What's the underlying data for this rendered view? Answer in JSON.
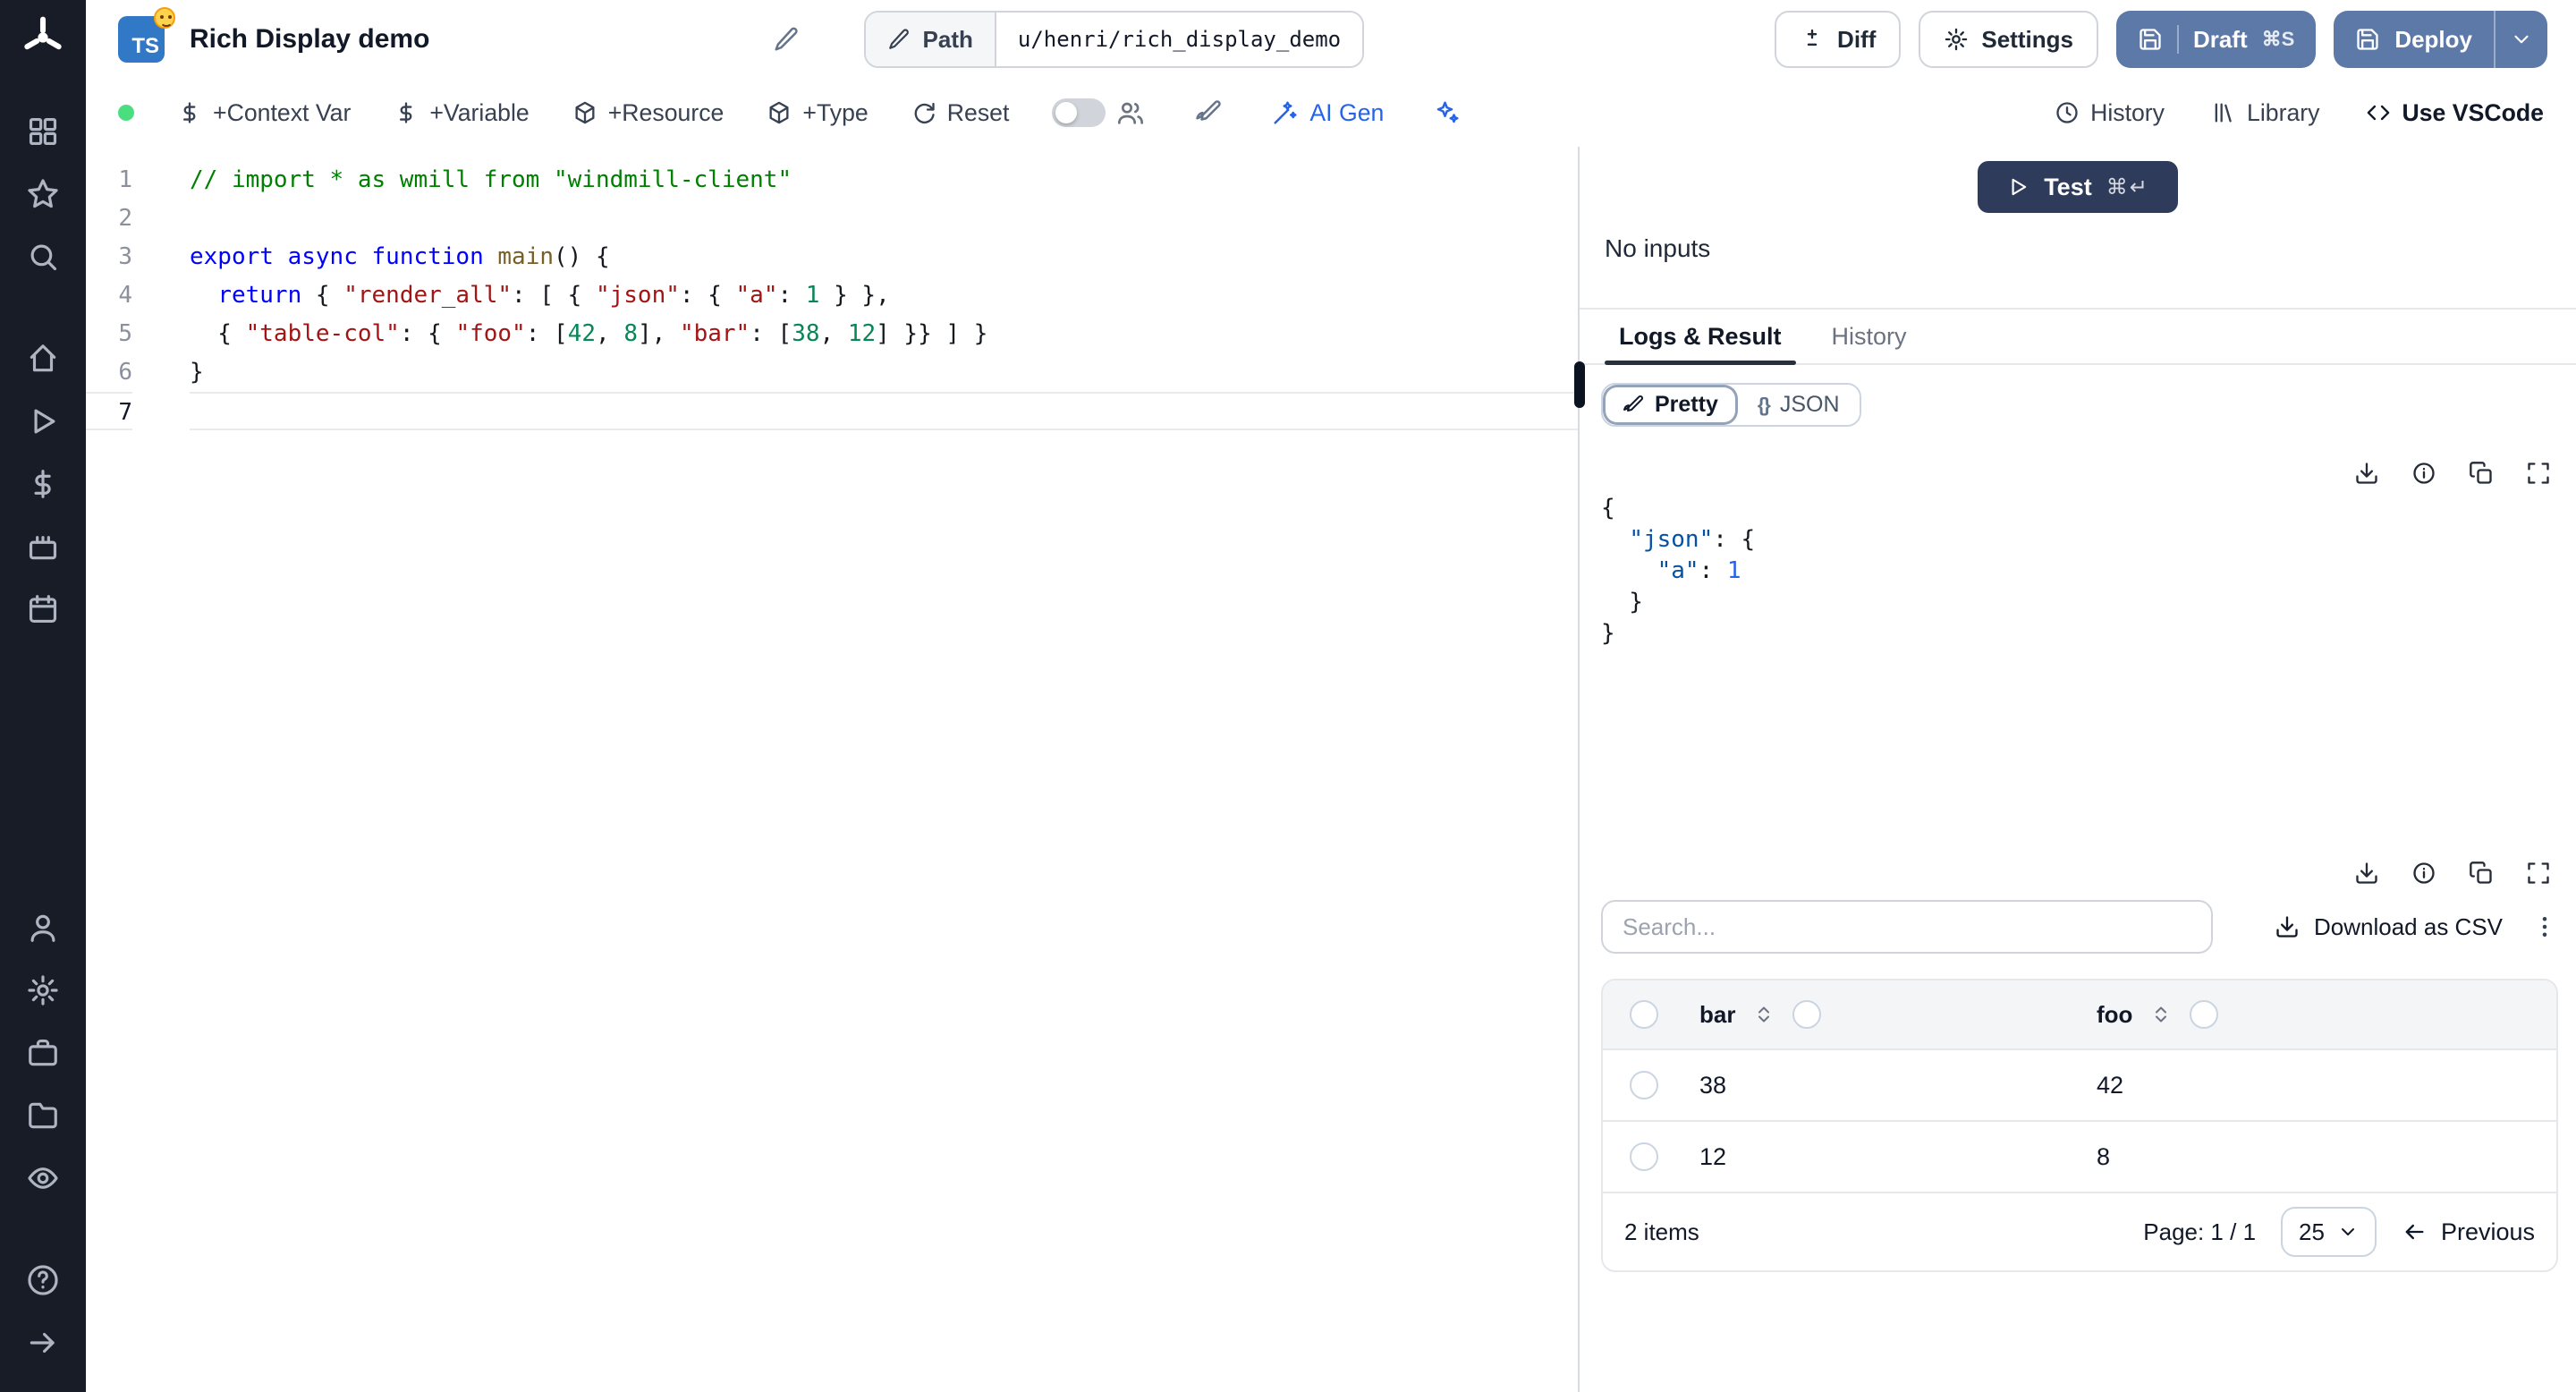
{
  "app": {
    "title": "Rich Display demo",
    "lang_badge": "TS"
  },
  "colors": {
    "sidebar": "#181c27",
    "primary_button": "#5d79a8",
    "test_button": "#2e3b5b",
    "status_ok": "#4ade80",
    "ai_accent": "#2563eb",
    "ts_badge": "#3178c6"
  },
  "header": {
    "path_label": "Path",
    "path_value": "u/henri/rich_display_demo",
    "diff_label": "Diff",
    "settings_label": "Settings",
    "draft_label": "Draft",
    "draft_shortcut": "⌘S",
    "deploy_label": "Deploy"
  },
  "toolbar": {
    "context_var": "+Context Var",
    "variable": "+Variable",
    "resource": "+Resource",
    "type": "+Type",
    "reset": "Reset",
    "ai_gen": "AI Gen",
    "history": "History",
    "library": "Library",
    "use_vscode": "Use VSCode"
  },
  "editor": {
    "cursor_line": 7,
    "lines": [
      [
        {
          "c": "cmt",
          "t": "// import * as wmill from \"windmill-client\""
        }
      ],
      [],
      [
        {
          "c": "kw",
          "t": "export"
        },
        {
          "c": "pl",
          "t": " "
        },
        {
          "c": "kw",
          "t": "async"
        },
        {
          "c": "pl",
          "t": " "
        },
        {
          "c": "kw",
          "t": "function"
        },
        {
          "c": "pl",
          "t": " "
        },
        {
          "c": "fn",
          "t": "main"
        },
        {
          "c": "pl",
          "t": "() {"
        }
      ],
      [
        {
          "c": "pl",
          "t": "  "
        },
        {
          "c": "kw",
          "t": "return"
        },
        {
          "c": "pl",
          "t": " { "
        },
        {
          "c": "str",
          "t": "\"render_all\""
        },
        {
          "c": "pl",
          "t": ": [ { "
        },
        {
          "c": "str",
          "t": "\"json\""
        },
        {
          "c": "pl",
          "t": ": { "
        },
        {
          "c": "str",
          "t": "\"a\""
        },
        {
          "c": "pl",
          "t": ": "
        },
        {
          "c": "num",
          "t": "1"
        },
        {
          "c": "pl",
          "t": " } },"
        }
      ],
      [
        {
          "c": "pl",
          "t": "  { "
        },
        {
          "c": "str",
          "t": "\"table-col\""
        },
        {
          "c": "pl",
          "t": ": { "
        },
        {
          "c": "str",
          "t": "\"foo\""
        },
        {
          "c": "pl",
          "t": ": ["
        },
        {
          "c": "num",
          "t": "42"
        },
        {
          "c": "pl",
          "t": ", "
        },
        {
          "c": "num",
          "t": "8"
        },
        {
          "c": "pl",
          "t": "], "
        },
        {
          "c": "str",
          "t": "\"bar\""
        },
        {
          "c": "pl",
          "t": ": ["
        },
        {
          "c": "num",
          "t": "38"
        },
        {
          "c": "pl",
          "t": ", "
        },
        {
          "c": "num",
          "t": "12"
        },
        {
          "c": "pl",
          "t": "] }} ] }"
        }
      ],
      [
        {
          "c": "pl",
          "t": "}"
        }
      ],
      []
    ]
  },
  "runner": {
    "test_label": "Test",
    "test_shortcut": "⌘↵",
    "no_inputs": "No inputs"
  },
  "tabs": {
    "logs_result": "Logs & Result",
    "history": "History"
  },
  "result": {
    "pretty_label": "Pretty",
    "json_label": "JSON",
    "json_lines": [
      [
        {
          "c": "pl",
          "t": "{"
        }
      ],
      [
        {
          "c": "pl",
          "t": "  "
        },
        {
          "c": "key",
          "t": "\"json\""
        },
        {
          "c": "pl",
          "t": ": {"
        }
      ],
      [
        {
          "c": "pl",
          "t": "    "
        },
        {
          "c": "key",
          "t": "\"a\""
        },
        {
          "c": "pl",
          "t": ": "
        },
        {
          "c": "num2",
          "t": "1"
        }
      ],
      [
        {
          "c": "pl",
          "t": "  }"
        }
      ],
      [
        {
          "c": "pl",
          "t": "}"
        }
      ]
    ]
  },
  "table": {
    "search_placeholder": "Search...",
    "download_csv": "Download as CSV",
    "columns": [
      "bar",
      "foo"
    ],
    "rows": [
      [
        "38",
        "42"
      ],
      [
        "12",
        "8"
      ]
    ],
    "items_count": "2 items",
    "page_label": "Page: 1 / 1",
    "page_size": "25",
    "previous_label": "Previous"
  }
}
